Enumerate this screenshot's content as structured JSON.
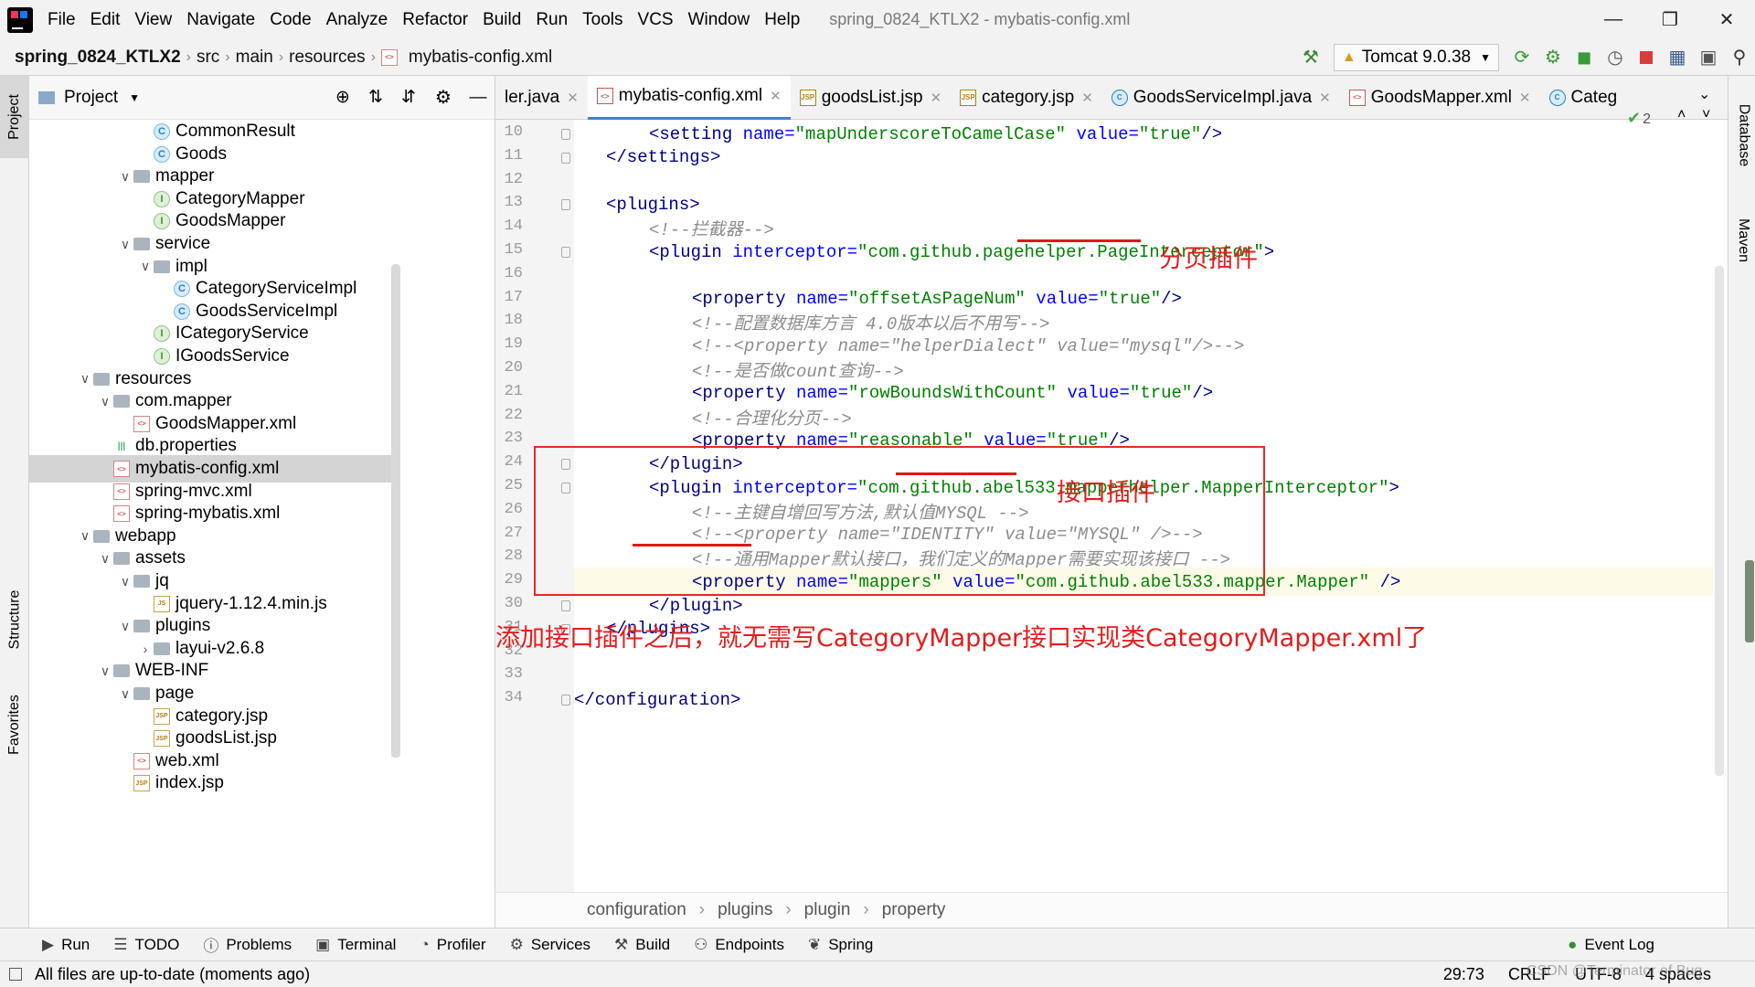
{
  "title_bar": {
    "menu": [
      "File",
      "Edit",
      "View",
      "Navigate",
      "Code",
      "Analyze",
      "Refactor",
      "Build",
      "Run",
      "Tools",
      "VCS",
      "Window",
      "Help"
    ],
    "window_title": "spring_0824_KTLX2 - mybatis-config.xml"
  },
  "nav": {
    "crumbs": [
      "spring_0824_KTLX2",
      "src",
      "main",
      "resources",
      "mybatis-config.xml"
    ],
    "run_config": "Tomcat 9.0.38"
  },
  "left_stripe": {
    "project": "Project",
    "structure": "Structure",
    "favorites": "Favorites"
  },
  "right_stripe": {
    "database": "Database",
    "maven": "Maven"
  },
  "project_panel": {
    "title": "Project",
    "rows": [
      {
        "label": "CommonResult",
        "icon": "class"
      },
      {
        "label": "Goods",
        "icon": "class"
      },
      {
        "label": "mapper",
        "icon": "folder",
        "arrow": "expanded"
      },
      {
        "label": "CategoryMapper",
        "icon": "interface"
      },
      {
        "label": "GoodsMapper",
        "icon": "interface"
      },
      {
        "label": "service",
        "icon": "folder",
        "arrow": "expanded"
      },
      {
        "label": "impl",
        "icon": "folder",
        "arrow": "expanded"
      },
      {
        "label": "CategoryServiceImpl",
        "icon": "class"
      },
      {
        "label": "GoodsServiceImpl",
        "icon": "class"
      },
      {
        "label": "ICategoryService",
        "icon": "interface"
      },
      {
        "label": "IGoodsService",
        "icon": "interface"
      },
      {
        "label": "resources",
        "icon": "folder",
        "arrow": "expanded"
      },
      {
        "label": "com.mapper",
        "icon": "folder",
        "arrow": "expanded"
      },
      {
        "label": "GoodsMapper.xml",
        "icon": "xml"
      },
      {
        "label": "db.properties",
        "icon": "props"
      },
      {
        "label": "mybatis-config.xml",
        "icon": "xml",
        "selected": true
      },
      {
        "label": "spring-mvc.xml",
        "icon": "xml"
      },
      {
        "label": "spring-mybatis.xml",
        "icon": "xml"
      },
      {
        "label": "webapp",
        "icon": "folder",
        "arrow": "expanded"
      },
      {
        "label": "assets",
        "icon": "folder",
        "arrow": "expanded"
      },
      {
        "label": "jq",
        "icon": "folder",
        "arrow": "expanded"
      },
      {
        "label": "jquery-1.12.4.min.js",
        "icon": "js"
      },
      {
        "label": "plugins",
        "icon": "folder",
        "arrow": "expanded"
      },
      {
        "label": "layui-v2.6.8",
        "icon": "folder",
        "arrow": "collapsed"
      },
      {
        "label": "WEB-INF",
        "icon": "folder",
        "arrow": "expanded"
      },
      {
        "label": "page",
        "icon": "folder",
        "arrow": "expanded"
      },
      {
        "label": "category.jsp",
        "icon": "jsp"
      },
      {
        "label": "goodsList.jsp",
        "icon": "jsp"
      },
      {
        "label": "web.xml",
        "icon": "xml"
      },
      {
        "label": "index.jsp",
        "icon": "jsp"
      }
    ]
  },
  "editor_tabs": [
    {
      "label": "ler.java",
      "icon": "java"
    },
    {
      "label": "mybatis-config.xml",
      "icon": "xml",
      "active": true
    },
    {
      "label": "goodsList.jsp",
      "icon": "jsp"
    },
    {
      "label": "category.jsp",
      "icon": "jsp"
    },
    {
      "label": "GoodsServiceImpl.java",
      "icon": "class"
    },
    {
      "label": "GoodsMapper.xml",
      "icon": "xml"
    },
    {
      "label": "Categ",
      "icon": "class"
    }
  ],
  "editor": {
    "line_numbers": [
      "10",
      "11",
      "12",
      "13",
      "14",
      "15",
      "16",
      "17",
      "18",
      "19",
      "20",
      "21",
      "22",
      "23",
      "24",
      "25",
      "26",
      "27",
      "28",
      "29",
      "30",
      "31",
      "32",
      "33",
      "34"
    ],
    "check_count": "2",
    "lines": [
      {
        "indent": 2,
        "parts": [
          [
            "tg",
            "<setting "
          ],
          [
            "at",
            "name="
          ],
          [
            "av",
            "\"mapUnderscoreToCamelCase\""
          ],
          [
            "at",
            " value="
          ],
          [
            "av",
            "\"true\""
          ],
          [
            "tg",
            "/>"
          ]
        ]
      },
      {
        "indent": 1,
        "parts": [
          [
            "tg",
            "</settings>"
          ]
        ]
      },
      {
        "indent": 0,
        "parts": []
      },
      {
        "indent": 1,
        "parts": [
          [
            "tg",
            "<plugins>"
          ]
        ]
      },
      {
        "indent": 2,
        "parts": [
          [
            "cm",
            "<!--拦截器-->"
          ]
        ]
      },
      {
        "indent": 2,
        "parts": [
          [
            "tg",
            "<plugin "
          ],
          [
            "at",
            "interceptor="
          ],
          [
            "av",
            "\"com.github.pagehelper.PageInterceptor\""
          ],
          [
            "tg",
            ">"
          ]
        ]
      },
      {
        "indent": 0,
        "parts": []
      },
      {
        "indent": 3,
        "parts": [
          [
            "tg",
            "<property "
          ],
          [
            "at",
            "name="
          ],
          [
            "av",
            "\"offsetAsPageNum\""
          ],
          [
            "at",
            " value="
          ],
          [
            "av",
            "\"true\""
          ],
          [
            "tg",
            "/>"
          ]
        ]
      },
      {
        "indent": 3,
        "parts": [
          [
            "cm",
            "<!--配置数据库方言 4.0版本以后不用写-->"
          ]
        ]
      },
      {
        "indent": 3,
        "parts": [
          [
            "cm",
            "<!--<property name=\"helperDialect\" value=\"mysql\"/>-->"
          ]
        ]
      },
      {
        "indent": 3,
        "parts": [
          [
            "cm",
            "<!--是否做count查询-->"
          ]
        ]
      },
      {
        "indent": 3,
        "parts": [
          [
            "tg",
            "<property "
          ],
          [
            "at",
            "name="
          ],
          [
            "av",
            "\"rowBoundsWithCount\""
          ],
          [
            "at",
            " value="
          ],
          [
            "av",
            "\"true\""
          ],
          [
            "tg",
            "/>"
          ]
        ]
      },
      {
        "indent": 3,
        "parts": [
          [
            "cm",
            "<!--合理化分页-->"
          ]
        ]
      },
      {
        "indent": 3,
        "parts": [
          [
            "tg",
            "<property "
          ],
          [
            "at",
            "name="
          ],
          [
            "av",
            "\"reasonable\""
          ],
          [
            "at",
            " value="
          ],
          [
            "av",
            "\"true\""
          ],
          [
            "tg",
            "/>"
          ]
        ]
      },
      {
        "indent": 2,
        "parts": [
          [
            "tg",
            "</plugin>"
          ]
        ]
      },
      {
        "indent": 2,
        "parts": [
          [
            "tg",
            "<plugin "
          ],
          [
            "at",
            "interceptor="
          ],
          [
            "av",
            "\"com.github.abel533.mapperhelper.MapperInterceptor\""
          ],
          [
            "tg",
            ">"
          ]
        ]
      },
      {
        "indent": 3,
        "parts": [
          [
            "cm",
            "<!--主键自增回写方法,默认值MYSQL -->"
          ]
        ]
      },
      {
        "indent": 3,
        "parts": [
          [
            "cm",
            "<!--<property name=\"IDENTITY\" value=\"MYSQL\" />-->"
          ]
        ]
      },
      {
        "indent": 3,
        "parts": [
          [
            "cm",
            "<!--通用Mapper默认接口，我们定义的Mapper需要实现该接口 -->"
          ]
        ]
      },
      {
        "indent": 3,
        "parts": [
          [
            "tg",
            "<property "
          ],
          [
            "at",
            "name="
          ],
          [
            "av",
            "\"mappers\""
          ],
          [
            "at",
            " value="
          ],
          [
            "av",
            "\"com.github.abel533.mapper.Mapper\""
          ],
          [
            "tg",
            " />"
          ]
        ],
        "current": true
      },
      {
        "indent": 2,
        "parts": [
          [
            "tg",
            "</plugin>"
          ]
        ]
      },
      {
        "indent": 1,
        "parts": [
          [
            "tg",
            "</plugins>"
          ]
        ]
      },
      {
        "indent": 0,
        "parts": []
      },
      {
        "indent": 0,
        "parts": []
      },
      {
        "indent": 0,
        "parts": [
          [
            "tg",
            "</configuration>"
          ]
        ]
      }
    ],
    "annotations": {
      "paging_plugin": "分页插件",
      "interface_plugin": "接口插件",
      "note": "添加接口插件之后，就无需写CategoryMapper接口实现类CategoryMapper.xml了"
    },
    "breadcrumb": [
      "configuration",
      "plugins",
      "plugin",
      "property"
    ]
  },
  "bottom_tools": [
    {
      "label": "Run",
      "icon": "play-icon"
    },
    {
      "label": "TODO",
      "icon": "list-icon"
    },
    {
      "label": "Problems",
      "icon": "info-icon"
    },
    {
      "label": "Terminal",
      "icon": "terminal-icon"
    },
    {
      "label": "Profiler",
      "icon": "profiler-icon"
    },
    {
      "label": "Services",
      "icon": "services-icon"
    },
    {
      "label": "Build",
      "icon": "hammer-icon"
    },
    {
      "label": "Endpoints",
      "icon": "endpoints-icon"
    },
    {
      "label": "Spring",
      "icon": "spring-icon"
    }
  ],
  "event_log": "Event Log",
  "status": {
    "message": "All files are up-to-date (moments ago)",
    "position": "29:73",
    "line_sep": "CRLF",
    "encoding": "UTF-8",
    "indent": "4 spaces",
    "watermark": "CSDN @Terminator of Bug"
  },
  "colors": {
    "tag": "#000080",
    "attr": "#0000ff",
    "value": "#008000",
    "comment": "#8c8c8c",
    "annotation": "#e21d1d",
    "accent": "#4083c9"
  }
}
